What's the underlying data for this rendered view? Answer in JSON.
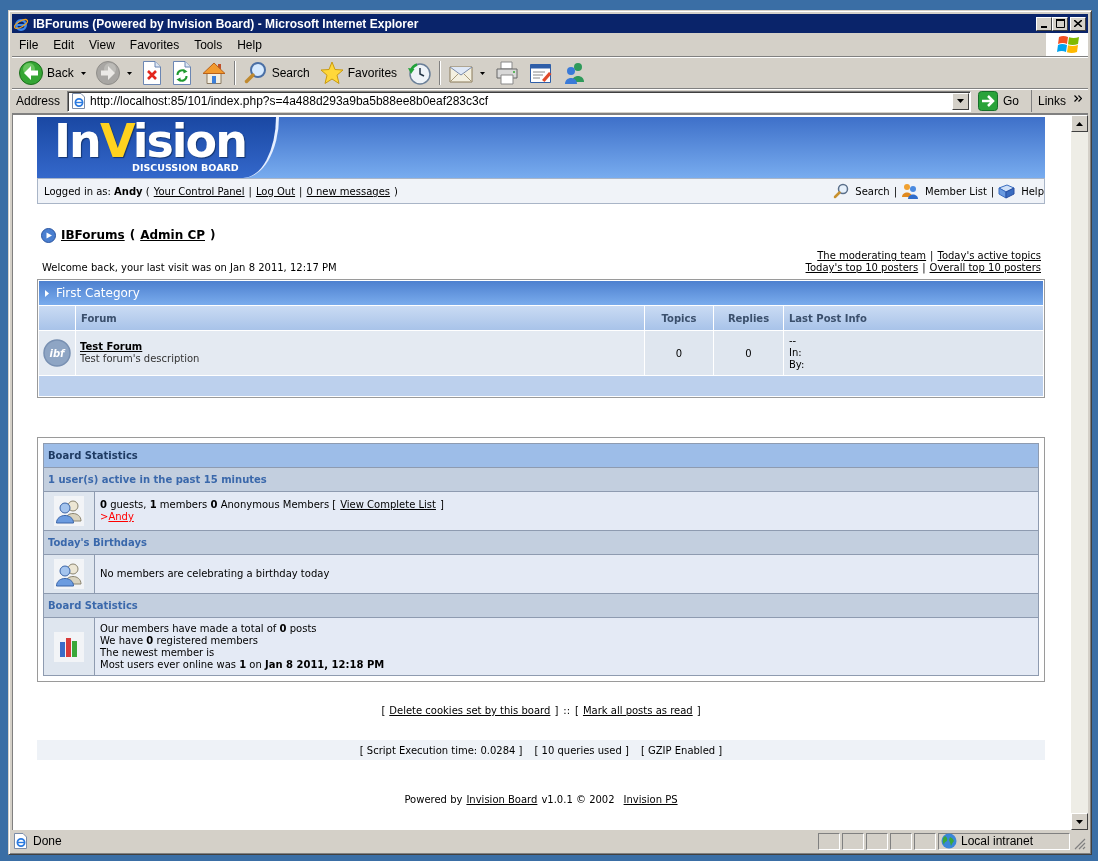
{
  "window": {
    "title": "IBForums (Powered by Invision Board) - Microsoft Internet Explorer"
  },
  "menu": [
    "File",
    "Edit",
    "View",
    "Favorites",
    "Tools",
    "Help"
  ],
  "toolbar": {
    "groups": [
      [
        {
          "kind": "back",
          "label": "Back",
          "dropdown": true,
          "disabled": false
        },
        {
          "kind": "forward",
          "dropdown": true,
          "disabled": true
        },
        {
          "kind": "stop",
          "disabled": false
        },
        {
          "kind": "refresh",
          "disabled": false
        },
        {
          "kind": "home",
          "disabled": false
        }
      ],
      [
        {
          "kind": "search",
          "label": "Search",
          "disabled": false
        },
        {
          "kind": "favorites",
          "label": "Favorites",
          "disabled": false
        },
        {
          "kind": "history",
          "disabled": false
        }
      ],
      [
        {
          "kind": "mail",
          "dropdown": true,
          "disabled": false
        },
        {
          "kind": "print",
          "disabled": false
        },
        {
          "kind": "edit",
          "disabled": false
        },
        {
          "kind": "chat",
          "disabled": false
        }
      ]
    ]
  },
  "address": {
    "label": "Address",
    "url": "http://localhost:85/101/index.php?s=4a488d293a9ba5b88ee8b0eaf283c3cf",
    "go": "Go",
    "links": "Links"
  },
  "header": {
    "logo": {
      "parts": [
        {
          "text": "In",
          "accent": false
        },
        {
          "text": "V",
          "accent": true
        },
        {
          "text": "ision",
          "accent": false
        }
      ],
      "tagline": "DISCUSSION BOARD"
    }
  },
  "userbar": {
    "greeting": "Logged in as: **Andy** (",
    "links": [
      "Your Control Panel",
      "Log Out",
      "0 new messages"
    ],
    "separator": "|",
    "close": ")",
    "tools": [
      {
        "kind": "search",
        "label": "Search"
      },
      {
        "kind": "members",
        "label": "Member List"
      },
      {
        "kind": "help",
        "label": "Help"
      }
    ]
  },
  "nav": {
    "links": [
      "IBForums",
      "Admin CP"
    ],
    "open": "(",
    "close": ")"
  },
  "welcome": "Welcome back, your last visit was on Jan 8 2011, 12:17 PM",
  "quick_links": {
    "rows": [
      [
        "The moderating team",
        "Today's active topics"
      ],
      [
        "Today's top 10 posters",
        "Overall top 10 posters"
      ]
    ],
    "separator": "|"
  },
  "category": {
    "title": "First Category",
    "columns": [
      "Forum",
      "Topics",
      "Replies",
      "Last Post Info"
    ],
    "forums": [
      {
        "icon_label": "ibf",
        "name": "Test Forum",
        "description": "Test forum's description",
        "topics": "0",
        "replies": "0",
        "last_post": [
          "--",
          "In:",
          "By:"
        ]
      }
    ]
  },
  "stats": {
    "title": "Board Statistics",
    "sections": [
      {
        "kind": "online",
        "heading": "1 user(s) active in the past 15 minutes",
        "summary": "**0** guests, **1** members **0** Anonymous Members [",
        "list_link": "View Complete List",
        "list_close": "]",
        "users": [
          {
            "prefix": ">",
            "name": "Andy",
            "color": "#ff0000"
          }
        ]
      },
      {
        "kind": "birthdays",
        "heading": "Today's Birthdays",
        "lines": [
          "No members are celebrating a birthday today"
        ]
      },
      {
        "kind": "totals",
        "heading": "Board Statistics",
        "lines": [
          "Our members have made a total of **0** posts",
          "We have **0** registered members",
          "The newest member is",
          "Most users ever online was **1** on **Jan 8 2011, 12:18 PM**"
        ]
      }
    ]
  },
  "footer": {
    "actions": [
      "Delete cookies set by this board",
      "Mark all posts as read"
    ],
    "open": "[",
    "close": "]",
    "joiner": "::"
  },
  "debug": [
    "[ Script Execution time: 0.0284 ]",
    "[ 10 queries used ]",
    "[ GZIP Enabled ]"
  ],
  "powered": {
    "prefix": "Powered by",
    "product": "Invision Board",
    "version": "v1.0.1 © 2002",
    "company": "Invision PS"
  },
  "status_bar": {
    "text": "Done",
    "zone": "Local intranet"
  }
}
